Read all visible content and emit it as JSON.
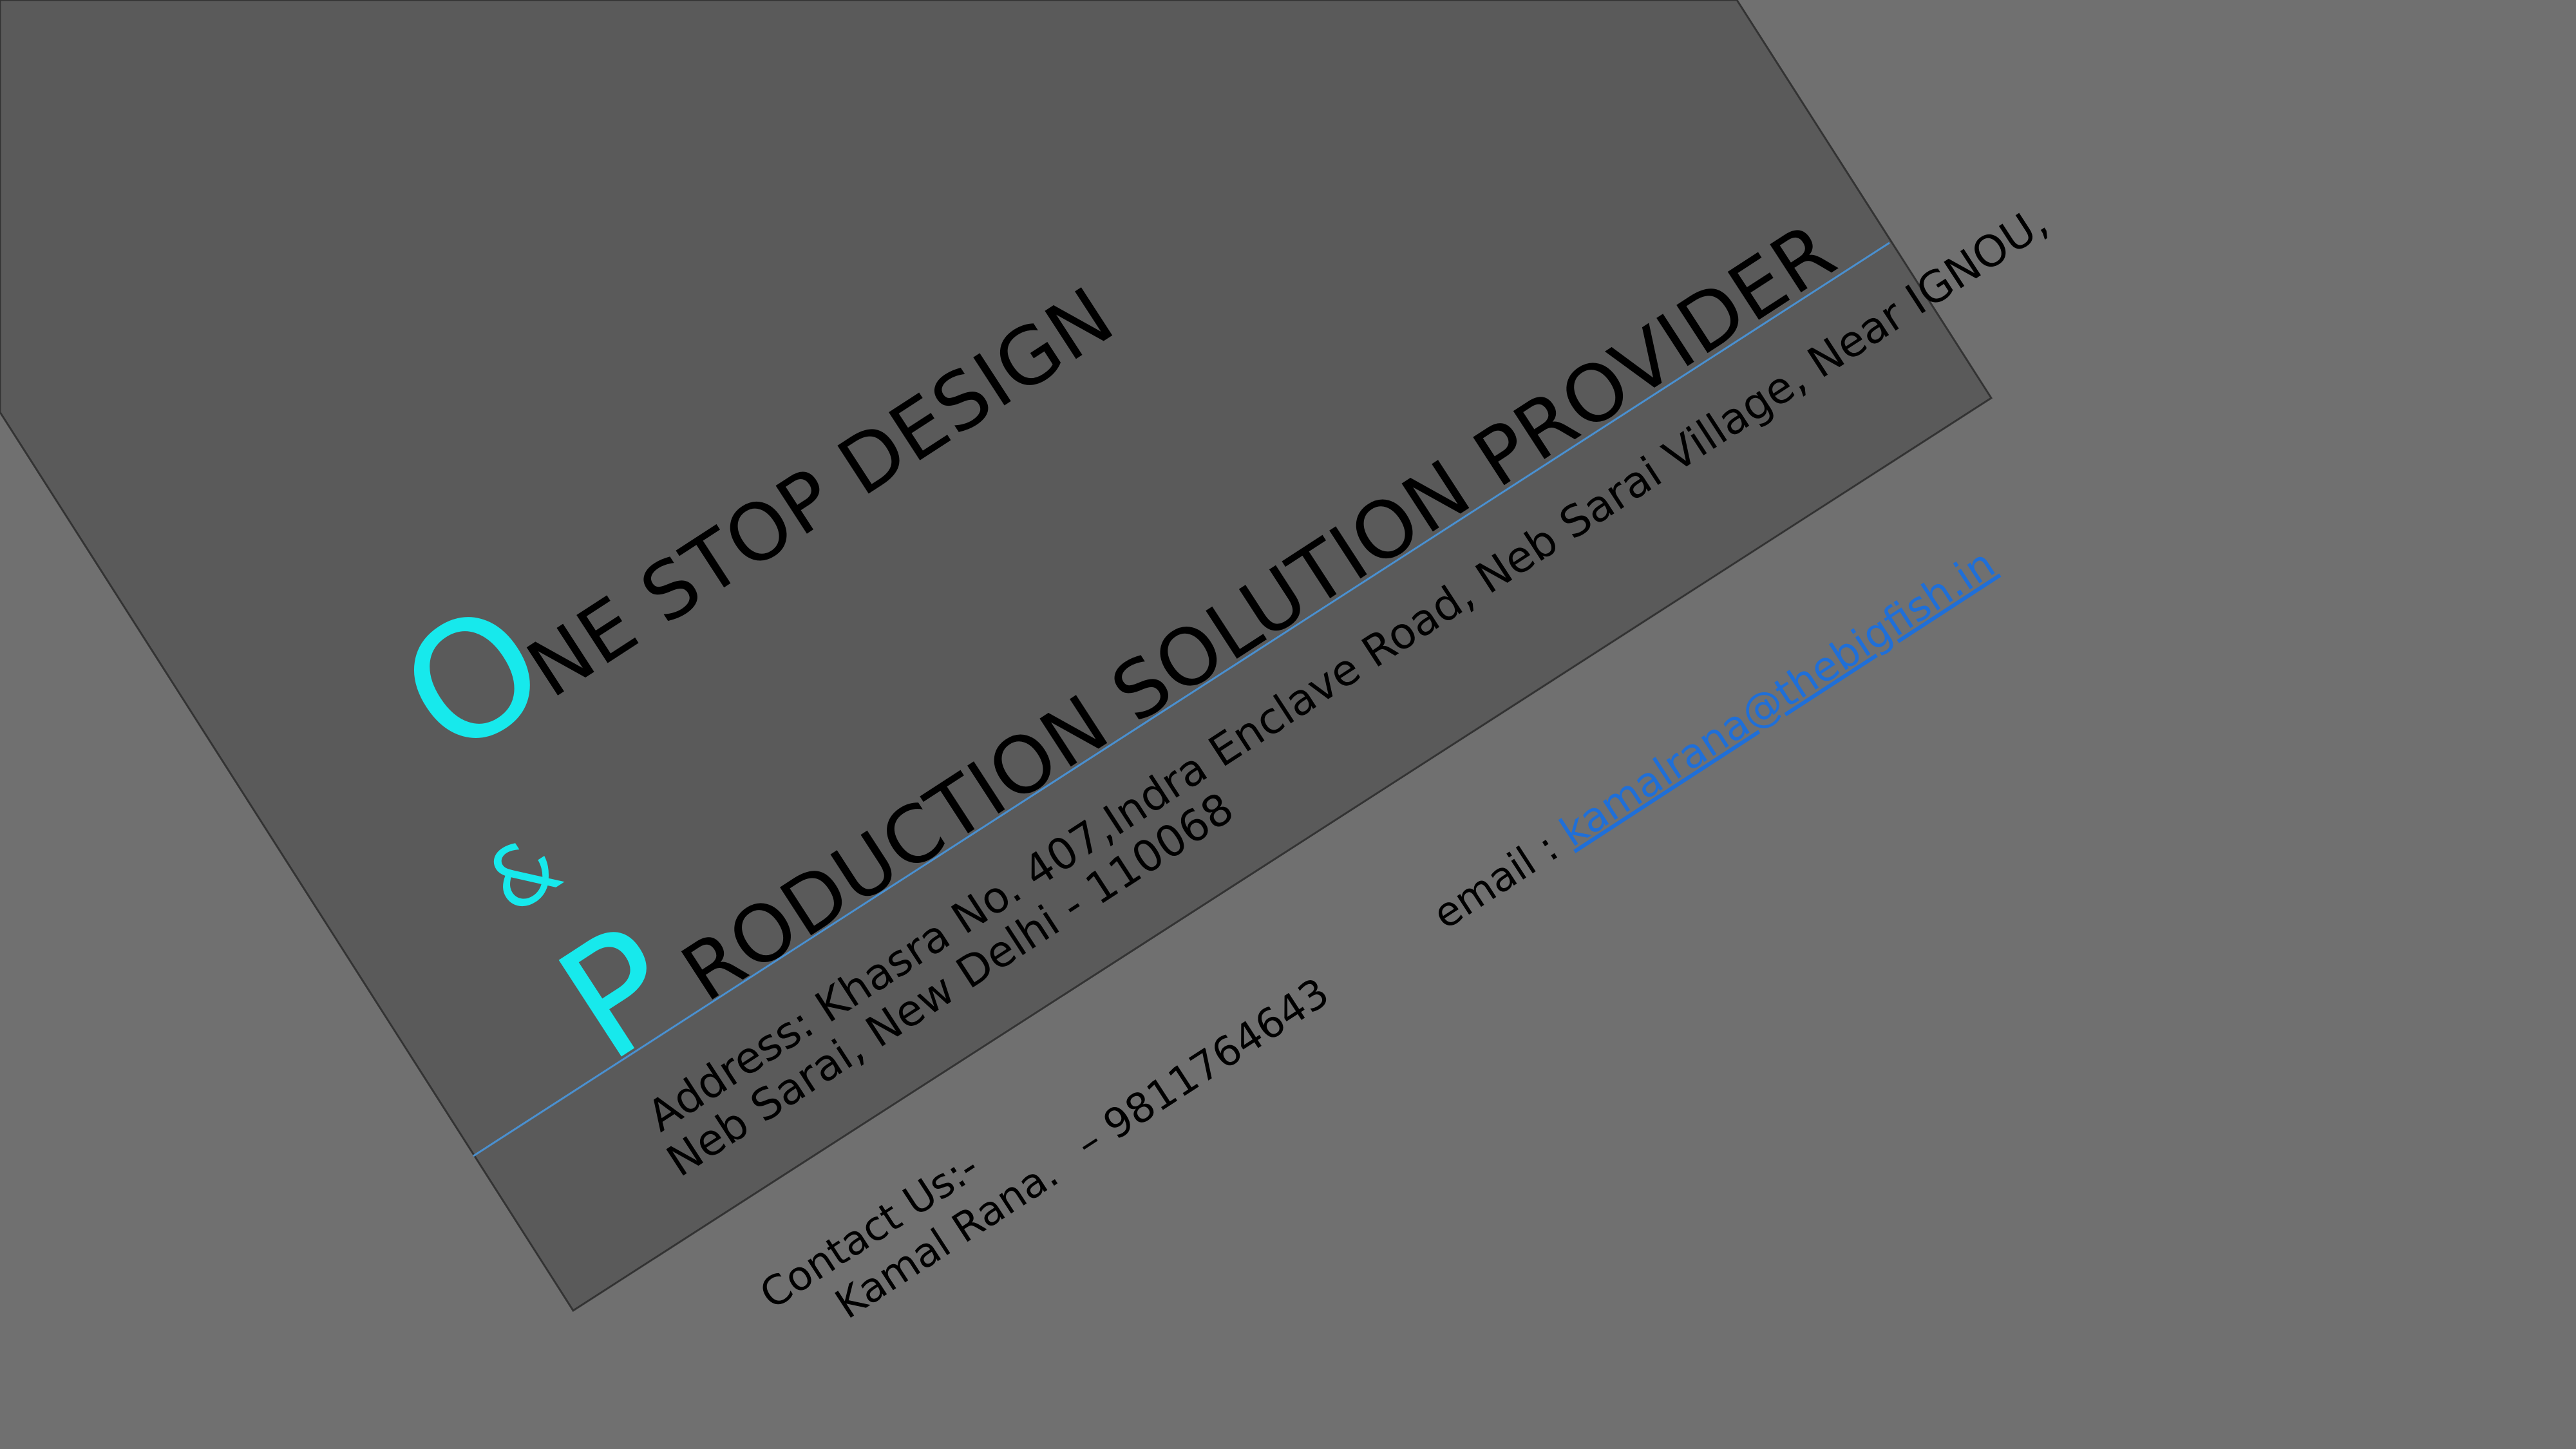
{
  "colors": {
    "background": "#707070",
    "panel": "#5a5a5a",
    "accent": "#17e9ec",
    "rule": "#4a90d0",
    "link": "#1f6fd8"
  },
  "tagline": {
    "line1_initial": "O",
    "line1_rest": "NE STOP DESIGN",
    "ampersand": "&",
    "line2_initial": "P",
    "line2_rest": "RODUCTION SOLUTION PROVIDER"
  },
  "address": {
    "line1": "Address: Khasra No. 407,Indra Enclave Road, Neb Sarai Village, Near IGNOU,",
    "line2": "Neb Sarai, New Delhi - 110068"
  },
  "contact": {
    "heading": "Contact Us:-",
    "name": "Kamal Rana.",
    "phone": "– 9811764643"
  },
  "email": {
    "label": "email : ",
    "address": "kamalrana@thebigfish.in"
  }
}
